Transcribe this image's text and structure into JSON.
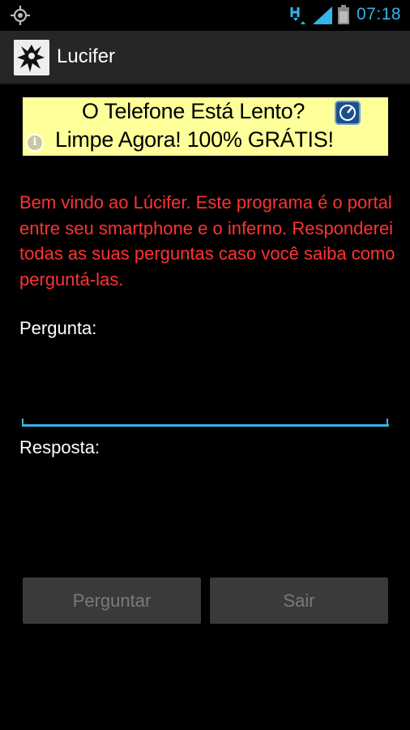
{
  "status_bar": {
    "time": "07:18",
    "accent_color": "#33b5e5",
    "icons": [
      "gps-icon",
      "hspa-icon",
      "signal-icon",
      "battery-icon"
    ]
  },
  "app": {
    "title": "Lucifer",
    "icon": "app-icon"
  },
  "ad": {
    "line1": "O Telefone Está Lento?",
    "line2": "Limpe Agora! 100% GRÁTIS!",
    "background_color": "#ffff99",
    "icons": [
      "ad-logo-icon",
      "info-icon"
    ]
  },
  "main": {
    "welcome_text": "Bem vindo ao Lúcifer. Este programa é o portal entre seu smartphone e o inferno. Responderei todas as suas perguntas caso você saiba como perguntá-las.",
    "welcome_color": "#ff3333",
    "question_label": "Pergunta:",
    "question_value": "",
    "answer_label": "Resposta:",
    "answer_value": ""
  },
  "buttons": {
    "ask_label": "Perguntar",
    "exit_label": "Sair"
  }
}
